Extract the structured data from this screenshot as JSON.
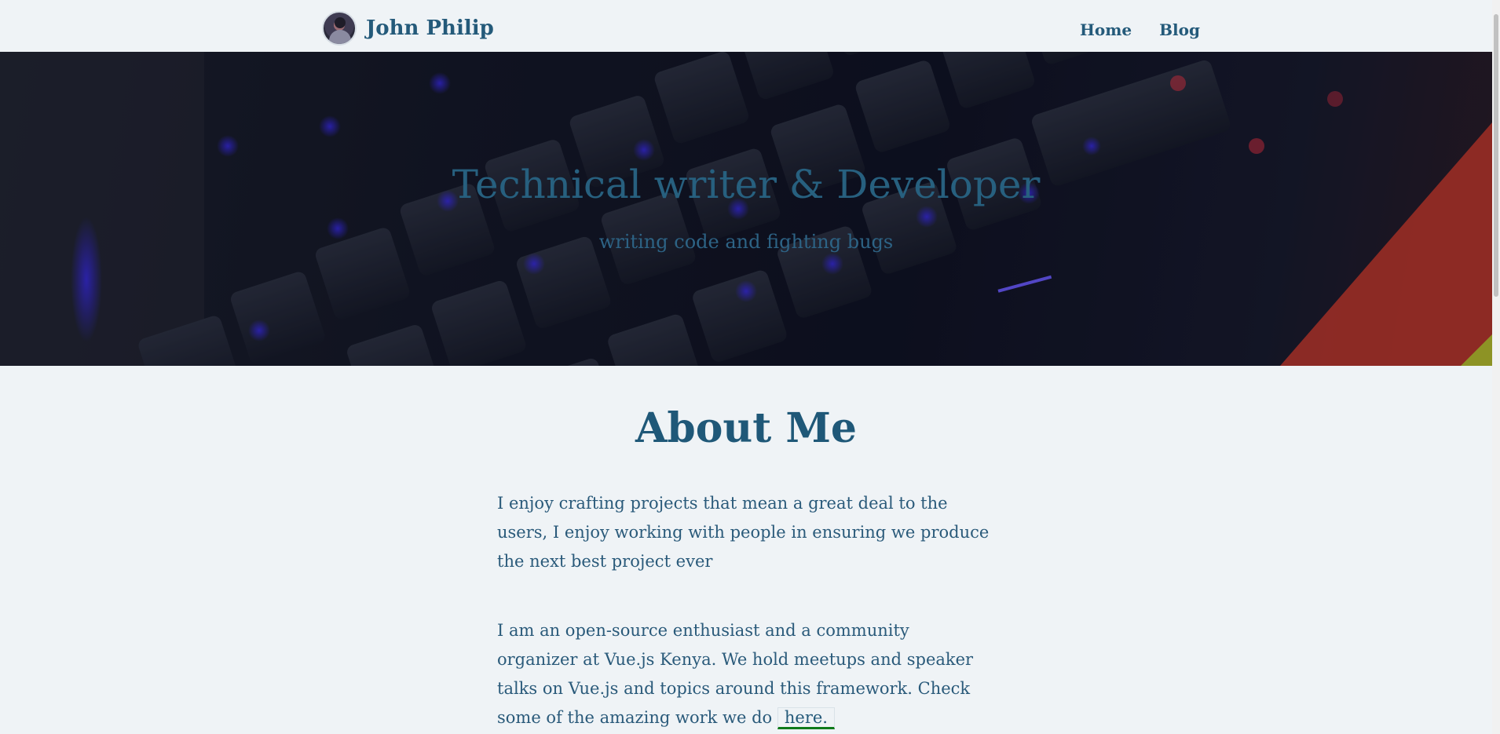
{
  "header": {
    "brand_name": "John Philip",
    "nav": [
      {
        "label": "Home"
      },
      {
        "label": "Blog"
      }
    ]
  },
  "hero": {
    "title": "Technical writer & Developer",
    "subtitle": "writing code and fighting bugs"
  },
  "about": {
    "heading": "About Me",
    "paragraph1": "I enjoy crafting projects that mean a great deal to the users, I enjoy working with people in ensuring we produce the next best project ever",
    "paragraph2_text": "I am an open-source enthusiast and a community organizer at Vue.js Kenya. We hold meetups and speaker talks on Vue.js and topics around this framework. Check some of the amazing work we do",
    "paragraph2_link": "here."
  },
  "colors": {
    "background": "#eff3f6",
    "accent": "#245a7a",
    "link_underline": "#0f7a1a"
  }
}
